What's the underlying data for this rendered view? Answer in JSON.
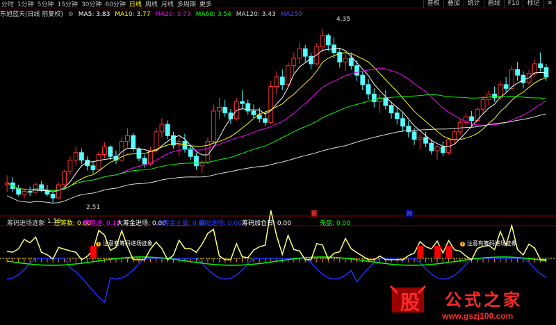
{
  "toolbar": {
    "timeframes": [
      "分时",
      "1分钟",
      "5分钟",
      "15分钟",
      "30分钟",
      "60分钟",
      "日线",
      "周线",
      "月线",
      "多周期",
      "更多"
    ],
    "active": "日线",
    "right_buttons": [
      "叠加",
      "统计",
      "画线",
      "F10",
      "标记"
    ],
    "overlay_label": "普权"
  },
  "ma_header": {
    "title": "东旭蓝天(日线 前复权)",
    "ma5": "MA5: 3.83",
    "ma10": "MA10: 3.77",
    "ma20": "MA20: 3.73",
    "ma60": "MA60: 3.54",
    "ma120": "MA120: 3.43",
    "ma250": "MA250"
  },
  "price_labels": {
    "high": "4.35",
    "low": "2.51"
  },
  "event_markers": [
    "募",
    "财"
  ],
  "indicator_header": {
    "name": "筹码进场迹象",
    "value": ": 1.50",
    "zhuangchou": "庄筹数: 0.00",
    "zhuangchu": "庄筹进: 0.14",
    "dachou_jin": "大筹金进场: 0.00",
    "dachou_zhu": "大筹金主量: 0.00",
    "baohu": "暴动进场: 0.00",
    "jiacang": "筹码加仓日: 0.00",
    "xianpan": "先盘: 0.00"
  },
  "annotations": [
    "注意有筹码进场迹象",
    "注意有筹码进场迹象"
  ],
  "watermark": {
    "gu": "股",
    "title": "公式之家",
    "url": "www.gszj100.com"
  },
  "colors": {
    "up": "#ff3232",
    "down": "#54ffff",
    "ma5": "#ffffff",
    "ma10": "#ffff00",
    "ma20": "#ff00ff",
    "ma60": "#00ff00",
    "ma120": "#dcdcdc",
    "ma250": "#4040ff",
    "active_tf": "#ffff00"
  },
  "chart_data": {
    "type": "candlestick",
    "ohlc": [
      [
        2.7,
        2.8,
        2.62,
        2.72
      ],
      [
        2.72,
        2.78,
        2.62,
        2.66
      ],
      [
        2.66,
        2.7,
        2.58,
        2.6
      ],
      [
        2.6,
        2.66,
        2.55,
        2.63
      ],
      [
        2.63,
        2.68,
        2.58,
        2.62
      ],
      [
        2.62,
        2.72,
        2.6,
        2.7
      ],
      [
        2.7,
        2.74,
        2.62,
        2.64
      ],
      [
        2.64,
        2.7,
        2.58,
        2.6
      ],
      [
        2.6,
        2.62,
        2.51,
        2.56
      ],
      [
        2.56,
        2.72,
        2.55,
        2.7
      ],
      [
        2.7,
        2.86,
        2.68,
        2.84
      ],
      [
        2.84,
        3.0,
        2.8,
        2.96
      ],
      [
        2.96,
        3.1,
        2.9,
        3.04
      ],
      [
        3.04,
        3.08,
        2.92,
        2.96
      ],
      [
        2.96,
        3.0,
        2.85,
        2.9
      ],
      [
        2.9,
        2.95,
        2.82,
        2.86
      ],
      [
        2.86,
        3.05,
        2.84,
        3.02
      ],
      [
        3.02,
        3.15,
        2.98,
        3.1
      ],
      [
        3.1,
        3.12,
        2.96,
        3.0
      ],
      [
        3.0,
        3.06,
        2.92,
        2.96
      ],
      [
        2.96,
        3.2,
        2.94,
        3.16
      ],
      [
        3.16,
        3.3,
        3.1,
        3.22
      ],
      [
        3.22,
        3.25,
        3.05,
        3.08
      ],
      [
        3.08,
        3.1,
        2.95,
        2.98
      ],
      [
        2.98,
        3.02,
        2.88,
        2.92
      ],
      [
        2.92,
        3.1,
        2.9,
        3.06
      ],
      [
        3.06,
        3.3,
        3.04,
        3.26
      ],
      [
        3.26,
        3.4,
        3.2,
        3.34
      ],
      [
        3.34,
        3.38,
        3.18,
        3.22
      ],
      [
        3.22,
        3.26,
        3.08,
        3.12
      ],
      [
        3.12,
        3.2,
        3.0,
        3.16
      ],
      [
        3.16,
        3.24,
        3.04,
        3.08
      ],
      [
        3.08,
        3.12,
        2.96,
        3.0
      ],
      [
        3.0,
        3.04,
        2.86,
        2.9
      ],
      [
        2.9,
        2.96,
        2.82,
        2.94
      ],
      [
        2.94,
        3.2,
        2.92,
        3.16
      ],
      [
        3.16,
        3.55,
        3.14,
        3.48
      ],
      [
        3.48,
        3.62,
        3.4,
        3.52
      ],
      [
        3.52,
        3.6,
        3.42,
        3.46
      ],
      [
        3.46,
        3.5,
        3.34,
        3.4
      ],
      [
        3.4,
        3.62,
        3.38,
        3.58
      ],
      [
        3.58,
        3.7,
        3.5,
        3.56
      ],
      [
        3.56,
        3.6,
        3.44,
        3.48
      ],
      [
        3.48,
        3.55,
        3.4,
        3.44
      ],
      [
        3.44,
        3.52,
        3.36,
        3.4
      ],
      [
        3.4,
        3.48,
        3.32,
        3.36
      ],
      [
        3.36,
        3.8,
        3.34,
        3.74
      ],
      [
        3.74,
        3.9,
        3.66,
        3.84
      ],
      [
        3.84,
        3.92,
        3.7,
        3.76
      ],
      [
        3.76,
        4.0,
        3.74,
        3.96
      ],
      [
        3.96,
        4.1,
        3.88,
        4.04
      ],
      [
        4.04,
        4.2,
        3.98,
        4.14
      ],
      [
        4.14,
        4.18,
        4.0,
        4.06
      ],
      [
        4.06,
        4.1,
        3.92,
        3.98
      ],
      [
        3.98,
        4.2,
        3.96,
        4.16
      ],
      [
        4.16,
        4.35,
        4.1,
        4.28
      ],
      [
        4.28,
        4.3,
        4.12,
        4.18
      ],
      [
        4.18,
        4.26,
        4.04,
        4.1
      ],
      [
        4.1,
        4.14,
        3.94,
        4.0
      ],
      [
        4.0,
        4.08,
        3.9,
        4.04
      ],
      [
        4.04,
        4.1,
        3.92,
        3.96
      ],
      [
        3.96,
        4.02,
        3.8,
        3.86
      ],
      [
        3.86,
        3.9,
        3.7,
        3.76
      ],
      [
        3.76,
        3.82,
        3.6,
        3.66
      ],
      [
        3.66,
        3.72,
        3.52,
        3.58
      ],
      [
        3.58,
        3.66,
        3.46,
        3.62
      ],
      [
        3.62,
        3.7,
        3.5,
        3.54
      ],
      [
        3.54,
        3.58,
        3.4,
        3.46
      ],
      [
        3.46,
        3.52,
        3.34,
        3.4
      ],
      [
        3.4,
        3.46,
        3.26,
        3.32
      ],
      [
        3.32,
        3.38,
        3.2,
        3.26
      ],
      [
        3.26,
        3.3,
        3.12,
        3.18
      ],
      [
        3.18,
        3.24,
        3.08,
        3.2
      ],
      [
        3.2,
        3.26,
        3.1,
        3.14
      ],
      [
        3.14,
        3.18,
        3.02,
        3.06
      ],
      [
        3.06,
        3.12,
        2.96,
        3.1
      ],
      [
        3.1,
        3.16,
        3.0,
        3.04
      ],
      [
        3.04,
        3.2,
        3.02,
        3.18
      ],
      [
        3.18,
        3.3,
        3.14,
        3.26
      ],
      [
        3.26,
        3.4,
        3.22,
        3.36
      ],
      [
        3.36,
        3.46,
        3.3,
        3.42
      ],
      [
        3.42,
        3.48,
        3.32,
        3.38
      ],
      [
        3.38,
        3.52,
        3.36,
        3.5
      ],
      [
        3.5,
        3.64,
        3.46,
        3.6
      ],
      [
        3.6,
        3.7,
        3.54,
        3.66
      ],
      [
        3.66,
        3.74,
        3.58,
        3.62
      ],
      [
        3.62,
        3.8,
        3.6,
        3.76
      ],
      [
        3.76,
        3.84,
        3.68,
        3.72
      ],
      [
        3.72,
        3.96,
        3.7,
        3.92
      ],
      [
        3.92,
        4.0,
        3.8,
        3.86
      ],
      [
        3.86,
        3.9,
        3.72,
        3.78
      ],
      [
        3.78,
        3.92,
        3.76,
        3.88
      ],
      [
        3.88,
        4.02,
        3.84,
        3.98
      ],
      [
        3.98,
        4.1,
        3.9,
        3.94
      ],
      [
        3.94,
        3.98,
        3.8,
        3.84
      ]
    ]
  }
}
